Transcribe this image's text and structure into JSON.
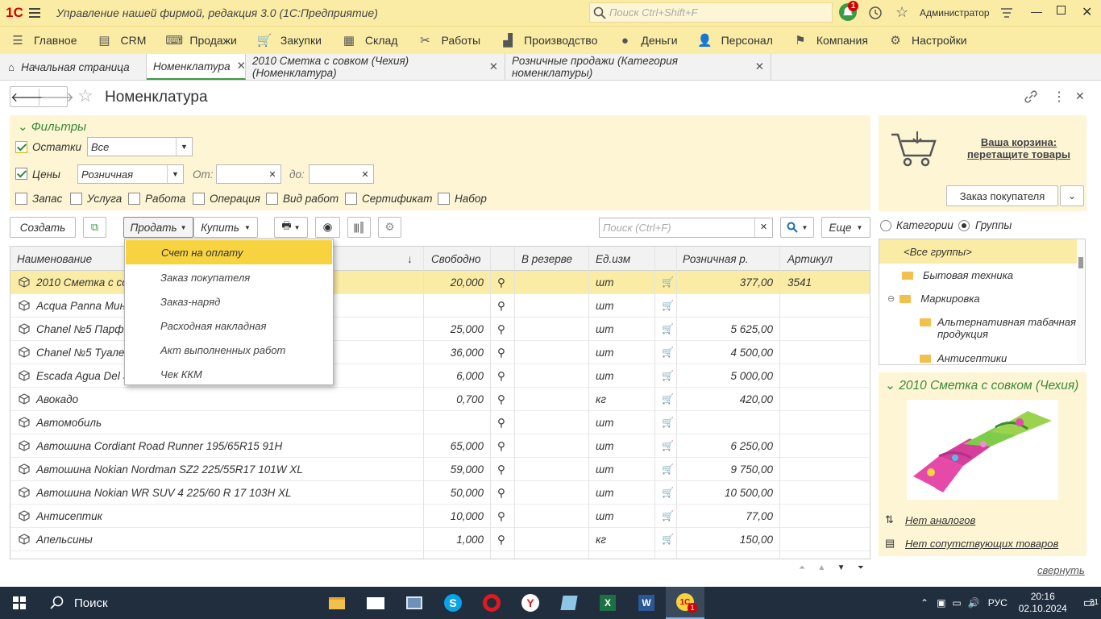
{
  "app": {
    "title": "Управление нашей фирмой, редакция 3.0  (1С:Предприятие)",
    "search_placeholder": "Поиск Ctrl+Shift+F",
    "user": "Администратор",
    "notifications": "1",
    "logo": "1С"
  },
  "menu": [
    {
      "label": "Главное",
      "icon": "menu-icon"
    },
    {
      "label": "CRM",
      "icon": "crm-icon"
    },
    {
      "label": "Продажи",
      "icon": "sales-icon"
    },
    {
      "label": "Закупки",
      "icon": "purchases-icon"
    },
    {
      "label": "Склад",
      "icon": "warehouse-icon"
    },
    {
      "label": "Работы",
      "icon": "tools-icon"
    },
    {
      "label": "Производство",
      "icon": "factory-icon"
    },
    {
      "label": "Деньги",
      "icon": "money-icon"
    },
    {
      "label": "Персонал",
      "icon": "person-icon"
    },
    {
      "label": "Компания",
      "icon": "flag-icon"
    },
    {
      "label": "Настройки",
      "icon": "gear-icon"
    }
  ],
  "tabs": [
    "Начальная страница",
    "Номенклатура",
    "2010 Сметка с совком (Чехия) (Номенклатура)",
    "Розничные продажи (Категория номенклатуры)"
  ],
  "page": {
    "title": "Номенклатура"
  },
  "filters": {
    "header": "Фильтры",
    "stock_label": "Остатки",
    "stock_value": "Все",
    "prices_label": "Цены",
    "price_type": "Розничная",
    "from_label": "От:",
    "to_label": "до:",
    "types": [
      "Запас",
      "Услуга",
      "Работа",
      "Операция",
      "Вид работ",
      "Сертификат",
      "Набор"
    ]
  },
  "toolbar": {
    "create": "Создать",
    "sell": "Продать",
    "buy": "Купить",
    "search_placeholder": "Поиск (Ctrl+F)",
    "more": "Еще"
  },
  "sell_menu": [
    "Счет на оплату",
    "Заказ покупателя",
    "Заказ-наряд",
    "Расходная накладная",
    "Акт выполненных работ",
    "Чек ККМ"
  ],
  "table": {
    "columns": [
      "Наименование",
      "Свободно",
      "В резерве",
      "Ед.изм",
      "Розничная р.",
      "Артикул"
    ],
    "rows": [
      {
        "name": "2010 Сметка с совком (Чехия)",
        "free": "20,000",
        "unit": "шт",
        "price": "377,00",
        "sku": "3541"
      },
      {
        "name": "Acqua Panna Минеральная вода",
        "free": "",
        "unit": "шт",
        "price": "",
        "sku": ""
      },
      {
        "name": "Chanel №5 Парфюмерная вода",
        "free": "25,000",
        "unit": "шт",
        "price": "5 625,00",
        "sku": ""
      },
      {
        "name": "Chanel №5 Туалетная вода",
        "free": "36,000",
        "unit": "шт",
        "price": "4 500,00",
        "sku": ""
      },
      {
        "name": "Escada Agua Del Sol",
        "free": "6,000",
        "unit": "шт",
        "price": "5 000,00",
        "sku": ""
      },
      {
        "name": "Авокадо",
        "free": "0,700",
        "unit": "кг",
        "price": "420,00",
        "sku": ""
      },
      {
        "name": "Автомобиль",
        "free": "",
        "unit": "шт",
        "price": "",
        "sku": ""
      },
      {
        "name": "Автошина Cordiant Road Runner 195/65R15 91H",
        "free": "65,000",
        "unit": "шт",
        "price": "6 250,00",
        "sku": ""
      },
      {
        "name": "Автошина Nokian Nordman SZ2 225/55R17 101W XL",
        "free": "59,000",
        "unit": "шт",
        "price": "9 750,00",
        "sku": ""
      },
      {
        "name": "Автошина Nokian WR SUV 4 225/60 R 17 103H XL",
        "free": "50,000",
        "unit": "шт",
        "price": "10 500,00",
        "sku": ""
      },
      {
        "name": "Антисептик",
        "free": "10,000",
        "unit": "шт",
        "price": "77,00",
        "sku": ""
      },
      {
        "name": "Апельсины",
        "free": "1,000",
        "unit": "кг",
        "price": "150,00",
        "sku": ""
      }
    ]
  },
  "cart": {
    "text1": "Ваша корзина:",
    "text2": "перетащите товары",
    "order_button": "Заказ покупателя"
  },
  "view": {
    "categories": "Категории",
    "groups": "Группы"
  },
  "groups": {
    "all": "<Все группы>",
    "items": [
      "Бытовая техника",
      "Маркировка",
      "Альтернативная табачная продукция",
      "Антисептики"
    ]
  },
  "product": {
    "title": "2010 Сметка с совком (Чехия)",
    "no_analogs": "Нет аналогов",
    "no_related": "Нет сопутствующих товаров",
    "collapse": "свернуть"
  },
  "taskbar": {
    "search": "Поиск",
    "lang": "РУС",
    "time": "20:16",
    "date": "02.10.2024",
    "notif": "21",
    "badge": "1"
  },
  "colors": {
    "accent_yellow": "#fbeca5",
    "highlight": "#f7d340",
    "green": "#3a9b45"
  }
}
